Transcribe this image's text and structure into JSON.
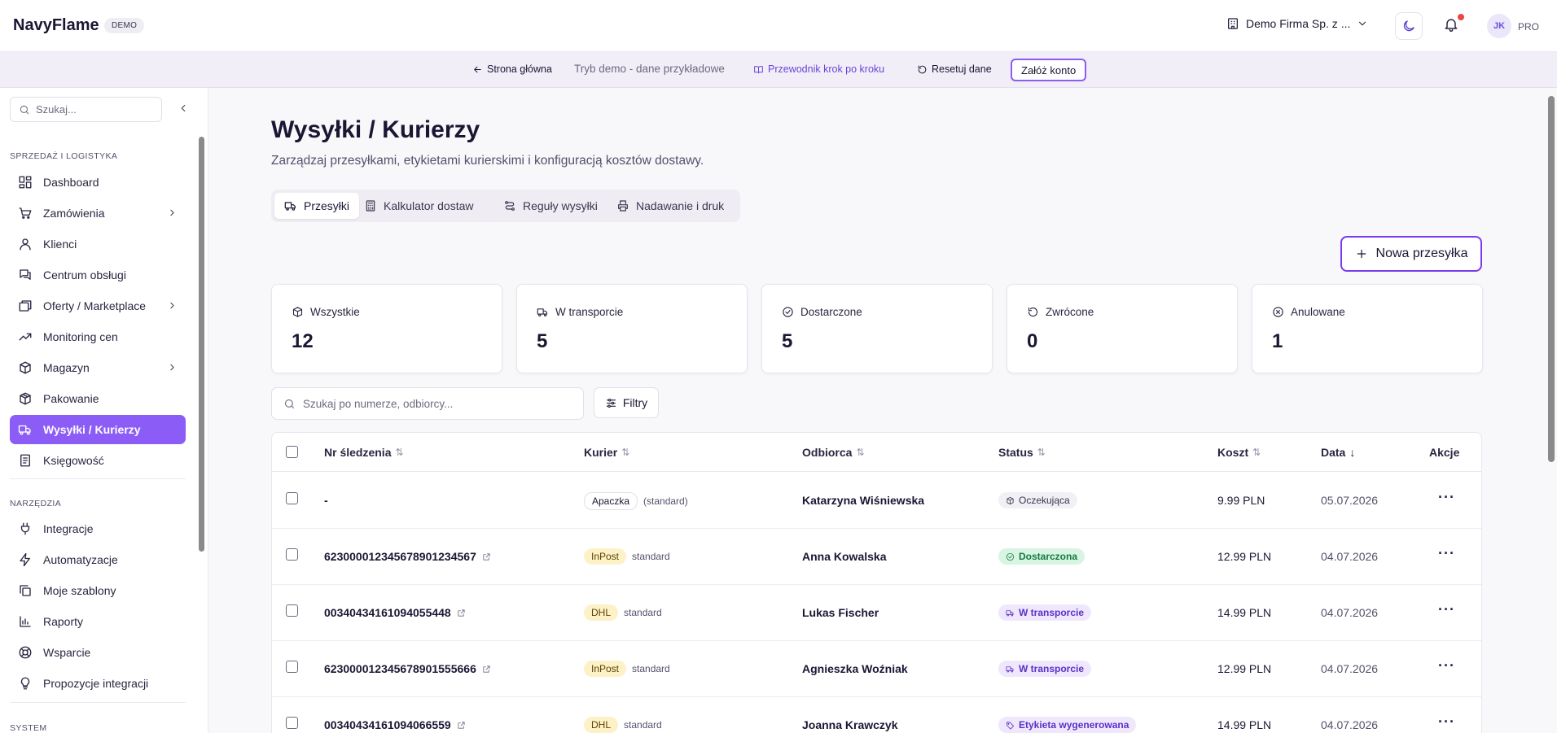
{
  "header": {
    "brand": "NavyFlame",
    "demo_badge": "DEMO",
    "company": "Demo Firma Sp. z ...",
    "avatar_initials": "JK",
    "plan": "PRO"
  },
  "demobar": {
    "home": "Strona główna",
    "mode": "Tryb demo - dane przykładowe",
    "guide": "Przewodnik krok po kroku",
    "reset": "Resetuj dane",
    "create_account": "Załóż konto"
  },
  "sidebar": {
    "search_placeholder": "Szukaj...",
    "sections": [
      {
        "label": "SPRZEDAŻ I LOGISTYKA",
        "items": [
          {
            "label": "Dashboard",
            "icon": "dashboard-icon"
          },
          {
            "label": "Zamówienia",
            "icon": "cart-icon",
            "has_children": true
          },
          {
            "label": "Klienci",
            "icon": "user-icon"
          },
          {
            "label": "Centrum obsługi",
            "icon": "chat-icon"
          },
          {
            "label": "Oferty / Marketplace",
            "icon": "offers-icon",
            "has_children": true
          },
          {
            "label": "Monitoring cen",
            "icon": "trend-icon"
          },
          {
            "label": "Magazyn",
            "icon": "box-icon",
            "has_children": true
          },
          {
            "label": "Pakowanie",
            "icon": "package-icon"
          },
          {
            "label": "Wysyłki / Kurierzy",
            "icon": "truck-icon",
            "active": true
          },
          {
            "label": "Księgowość",
            "icon": "receipt-icon"
          }
        ]
      },
      {
        "label": "NARZĘDZIA",
        "items": [
          {
            "label": "Integracje",
            "icon": "plug-icon"
          },
          {
            "label": "Automatyzacje",
            "icon": "bolt-icon"
          },
          {
            "label": "Moje szablony",
            "icon": "copy-icon"
          },
          {
            "label": "Raporty",
            "icon": "chart-icon"
          },
          {
            "label": "Wsparcie",
            "icon": "support-icon"
          },
          {
            "label": "Propozycje integracji",
            "icon": "bulb-icon"
          }
        ]
      },
      {
        "label": "SYSTEM",
        "items": []
      }
    ]
  },
  "page": {
    "title": "Wysyłki / Kurierzy",
    "subtitle": "Zarządzaj przesyłkami, etykietami kurierskimi i konfiguracją kosztów dostawy.",
    "tabs": [
      "Przesyłki",
      "Kalkulator dostaw",
      "Reguły wysyłki",
      "Nadawanie i druk"
    ],
    "new_button": "Nowa przesyłka"
  },
  "stats": [
    {
      "label": "Wszystkie",
      "value": "12",
      "icon": "box-icon"
    },
    {
      "label": "W transporcie",
      "value": "5",
      "icon": "truck-icon"
    },
    {
      "label": "Dostarczone",
      "value": "5",
      "icon": "check-circle-icon"
    },
    {
      "label": "Zwrócone",
      "value": "0",
      "icon": "undo-icon"
    },
    {
      "label": "Anulowane",
      "value": "1",
      "icon": "x-circle-icon"
    }
  ],
  "table": {
    "search_placeholder": "Szukaj po numerze, odbiorcy...",
    "filter_label": "Filtry",
    "columns": [
      "Nr śledzenia",
      "Kurier",
      "Odbiorca",
      "Status",
      "Koszt",
      "Data",
      "Akcje"
    ],
    "rows": [
      {
        "tracking": "-",
        "courier": "Apaczka",
        "service": "(standard)",
        "recipient": "Katarzyna Wiśniewska",
        "status": "Oczekująca",
        "cost": "9.99 PLN",
        "date": "05.07.2026"
      },
      {
        "tracking": "623000012345678901234567",
        "courier": "InPost",
        "service": "standard",
        "recipient": "Anna Kowalska",
        "status": "Dostarczona",
        "cost": "12.99 PLN",
        "date": "04.07.2026"
      },
      {
        "tracking": "00340434161094055448",
        "courier": "DHL",
        "service": "standard",
        "recipient": "Lukas Fischer",
        "status": "W transporcie",
        "cost": "14.99 PLN",
        "date": "04.07.2026"
      },
      {
        "tracking": "623000012345678901555666",
        "courier": "InPost",
        "service": "standard",
        "recipient": "Agnieszka Woźniak",
        "status": "W transporcie",
        "cost": "12.99 PLN",
        "date": "04.07.2026"
      },
      {
        "tracking": "00340434161094066559",
        "courier": "DHL",
        "service": "standard",
        "recipient": "Joanna Krawczyk",
        "status": "Etykieta wygenerowana",
        "cost": "14.99 PLN",
        "date": "04.07.2026"
      }
    ]
  },
  "colors": {
    "accent": "#8b5cf6",
    "accent_dark": "#7c3aed",
    "success": "#127a3e",
    "courier_yellow": "#fdf1c7"
  }
}
